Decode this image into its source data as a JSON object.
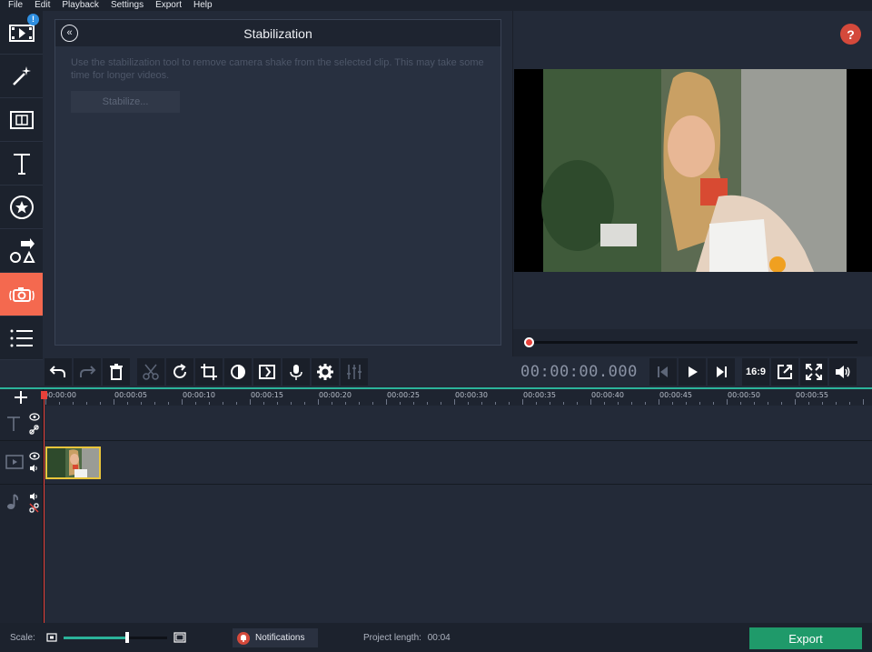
{
  "menu": [
    "File",
    "Edit",
    "Playback",
    "Settings",
    "Export",
    "Help"
  ],
  "sidebar": {
    "items": [
      {
        "icon": "import-media-icon",
        "badge": "!"
      },
      {
        "icon": "magic-wand-icon"
      },
      {
        "icon": "transitions-icon"
      },
      {
        "icon": "titles-icon"
      },
      {
        "icon": "stickers-icon"
      },
      {
        "icon": "callouts-icon"
      },
      {
        "icon": "stabilization-icon",
        "active": true
      },
      {
        "icon": "more-tools-icon"
      }
    ]
  },
  "panel": {
    "title": "Stabilization",
    "description": "Use the stabilization tool to remove camera shake from the selected clip. This may take some time for longer videos.",
    "stabilize_label": "Stabilize..."
  },
  "preview": {
    "help_label": "?",
    "scrub_progress": 0
  },
  "toolbar": {
    "timecode": "00:00:00.000",
    "aspect_ratio": "16:9"
  },
  "timeline": {
    "ticks": [
      "00:00:00",
      "00:00:05",
      "00:00:10",
      "00:00:15",
      "00:00:20",
      "00:00:25",
      "00:00:30",
      "00:00:35",
      "00:00:40",
      "00:00:45",
      "00:00:50",
      "00:00:55"
    ]
  },
  "status": {
    "scale_label": "Scale:",
    "notifications_label": "Notifications",
    "project_length_label": "Project length:",
    "project_length_value": "00:04",
    "export_label": "Export"
  },
  "colors": {
    "accent": "#f4694f",
    "export": "#1f9a6a",
    "timeline_line": "#2bb39a",
    "playhead": "#e8413a"
  }
}
